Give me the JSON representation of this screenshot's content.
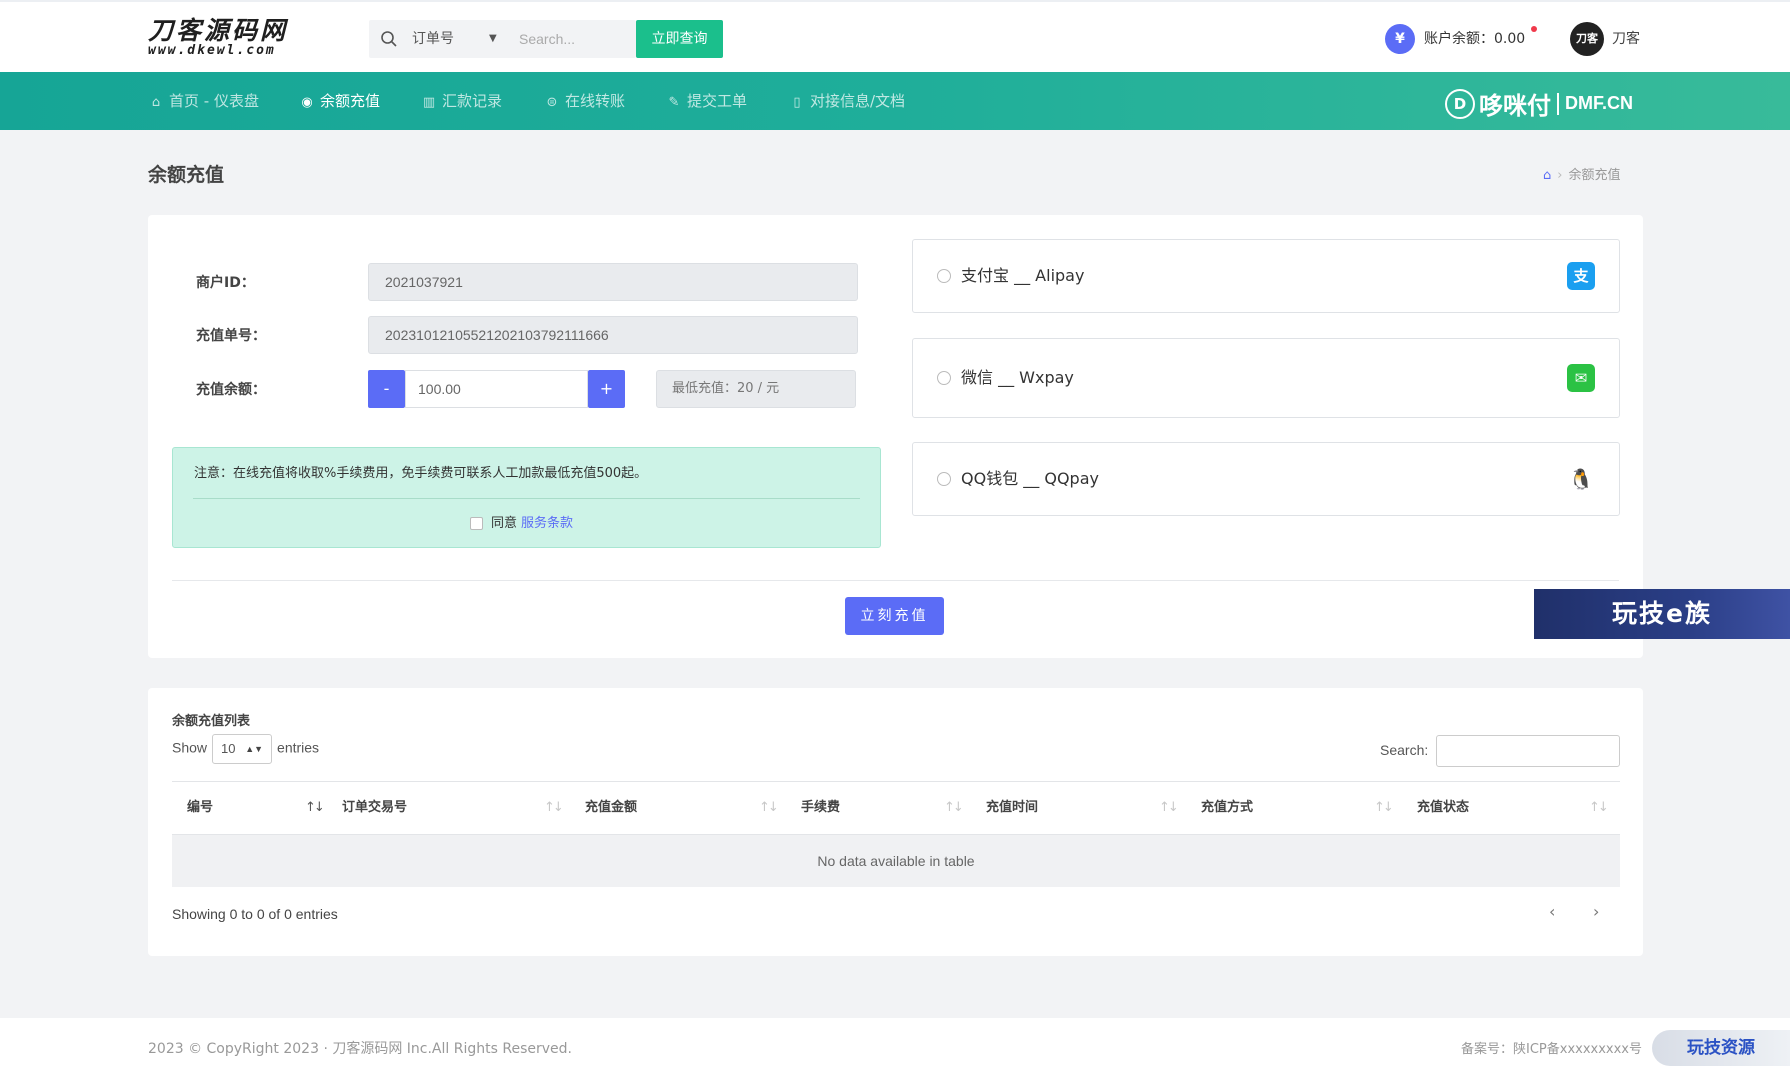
{
  "header": {
    "logo_line1": "刀客源码网",
    "logo_line2": "www.dkewl.com",
    "search_select": "订单号",
    "search_placeholder": "Search...",
    "search_button": "立即查询",
    "balance_label": "账户余额：0.00",
    "user_avatar_text": "刀客",
    "user_name": "刀客"
  },
  "nav": {
    "items": [
      {
        "label": "首页 - 仪表盘",
        "icon": "home-icon"
      },
      {
        "label": "余额充值",
        "icon": "target-icon"
      },
      {
        "label": "汇款记录",
        "icon": "bar-chart-icon"
      },
      {
        "label": "在线转账",
        "icon": "transfer-icon"
      },
      {
        "label": "提交工单",
        "icon": "edit-icon"
      },
      {
        "label": "对接信息/文档",
        "icon": "book-icon"
      }
    ],
    "brand_cn": "哆咪付",
    "brand_en": "DMF.CN"
  },
  "page": {
    "title": "余额充值",
    "breadcrumb_current": "余额充值"
  },
  "form": {
    "merchant_label": "商户ID：",
    "merchant_value": "2021037921",
    "order_label": "充值单号：",
    "order_value": "20231012105521202103792111666",
    "amount_label": "充值余额：",
    "minus": "-",
    "plus": "+",
    "amount_value": "100.00",
    "min_recharge": "最低充值：20 / 元",
    "notice": "注意：在线充值将收取%手续费用，免手续费可联系人工加款最低充值500起。",
    "agree_text": "同意",
    "agree_link": "服务条款",
    "submit": "立刻充值"
  },
  "payments": [
    {
      "label": "支付宝 __ Alipay",
      "icon": "alipay-icon",
      "color": "#1a9ff0"
    },
    {
      "label": "微信 __ Wxpay",
      "icon": "wechat-icon",
      "color": "#2bc244"
    },
    {
      "label": "QQ钱包 __ QQpay",
      "icon": "qq-icon",
      "color": "#222222"
    }
  ],
  "table": {
    "title": "余额充值列表",
    "show": "Show",
    "page_size": "10",
    "entries": "entries",
    "search_label": "Search:",
    "columns": [
      "编号",
      "订单交易号",
      "充值金额",
      "手续费",
      "充值时间",
      "充值方式",
      "充值状态"
    ],
    "empty": "No data available in table",
    "info": "Showing 0 to 0 of 0 entries",
    "prev": "‹",
    "next": "›"
  },
  "watermark": "玩技e族",
  "footer": {
    "copyright": "2023 © CopyRight 2023 · 刀客源码网 Inc.All Rights Reserved.",
    "icp": "备案号：陕ICP备xxxxxxxxx号",
    "watermark2": "玩技资源"
  },
  "colors": {
    "accent": "#5b6cf6",
    "nav_gradient_start": "#16a596",
    "nav_gradient_end": "#38bb9a",
    "query_button": "#1bbf8c",
    "notice_bg": "#cdf3e7"
  }
}
